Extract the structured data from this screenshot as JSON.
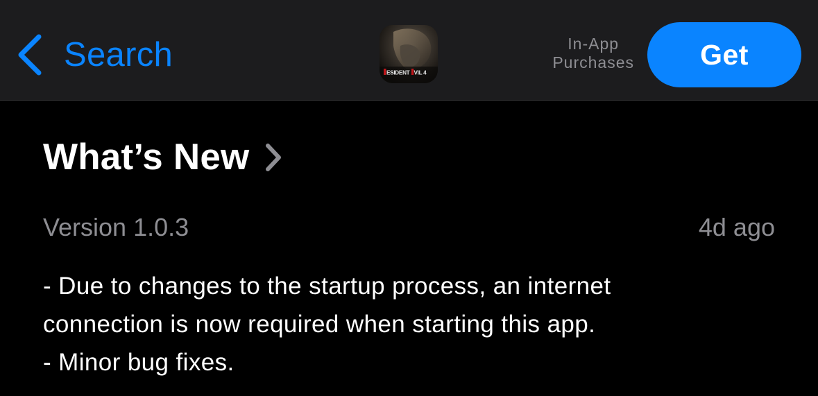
{
  "navbar": {
    "back_label": "Search",
    "app_icon": {
      "name": "resident-evil-4-app-icon",
      "overlay_text": "RESIDENT EVIL 4"
    },
    "in_app_line1": "In-App",
    "in_app_line2": "Purchases",
    "get_label": "Get"
  },
  "whats_new": {
    "title": "What’s New",
    "version": "Version 1.0.3",
    "date": "4d ago",
    "notes": [
      "- Due to changes to the startup process, an internet",
      "connection is now required when starting this app.",
      "- Minor bug fixes."
    ]
  },
  "colors": {
    "accent": "#0a84ff",
    "background": "#000000",
    "navbar_background": "#1c1c1e",
    "secondary_text": "#8e8e93",
    "primary_text": "#ffffff"
  }
}
